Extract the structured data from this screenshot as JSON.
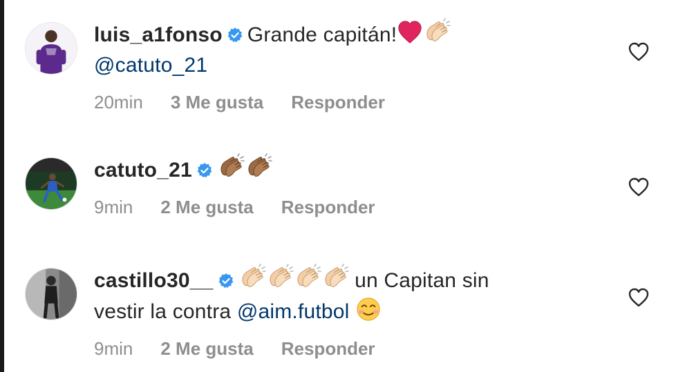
{
  "comments": [
    {
      "username": "luis_a1fonso",
      "text": "Grande capitán!",
      "mention": "@catuto_21",
      "text_after": "",
      "time": "20min",
      "likes": "3 Me gusta",
      "reply": "Responder",
      "emojis": [
        "red-heart",
        "clapping-hands-light"
      ]
    },
    {
      "username": "catuto_21",
      "text": "",
      "mention": "",
      "text_after": "",
      "time": "9min",
      "likes": "2 Me gusta",
      "reply": "Responder",
      "emojis": [
        "clapping-hands-dark",
        "clapping-hands-dark"
      ]
    },
    {
      "username": "castillo30__",
      "text": "un Capitan sin",
      "text_line2": "vestir la contra",
      "mention": "@aim.futbol",
      "time": "9min",
      "likes": "2 Me gusta",
      "reply": "Responder",
      "emojis": [
        "clapping-hands-light",
        "clapping-hands-light",
        "clapping-hands-light",
        "clapping-hands-light",
        "smiling-face"
      ]
    }
  ],
  "colors": {
    "text": "#262626",
    "meta": "#8e8e8e",
    "mention": "#00376b",
    "verified": "#3897f0"
  },
  "icons": {
    "verified": "verified-badge-icon",
    "like": "heart-outline-icon"
  }
}
